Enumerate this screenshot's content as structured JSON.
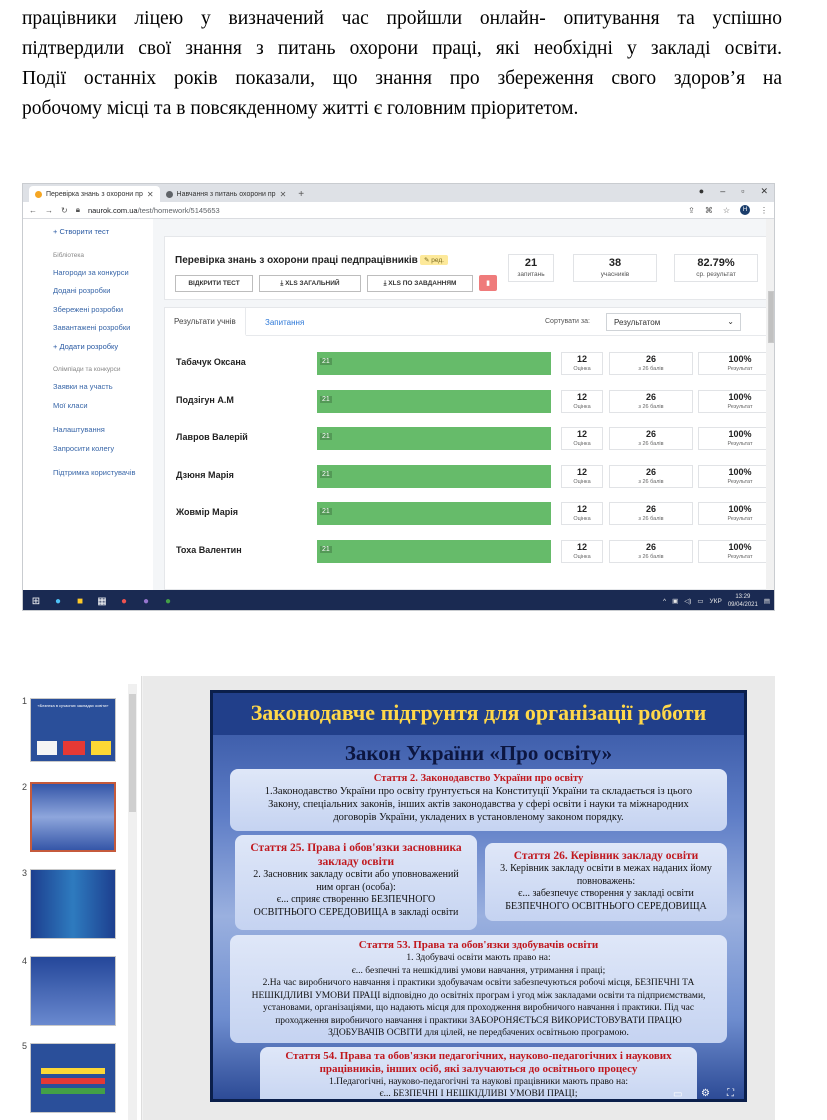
{
  "document": {
    "lines": [
      "працівники ліцею у визначений час пройшли онлайн- опитування та успішно",
      "підтвердили свої знання з питань охорони праці, які необхідні у закладі освіти.",
      "Події останніх років показали, що знання про збереження свого здоров’я на",
      "робочому місці та в повсякденному житті є головним пріоритетом."
    ]
  },
  "browser": {
    "tabs": [
      {
        "label": "Перевірка знань з охорони пр"
      },
      {
        "label": "Навчання з питань охорони пр"
      }
    ],
    "new_tab": "+",
    "url_host": "naurok.com.ua",
    "url_path": "/test/homework/5145653",
    "profile_initial": "Н"
  },
  "sidebar": {
    "create_test": "+ Створити тест",
    "library_title": "Бібліотека",
    "library_items": [
      "Нагороди за конкурси",
      "Додані розробки",
      "Збережені розробки",
      "Завантажені розробки"
    ],
    "add_dev": "+ Додати розробку",
    "olymp_title": "Олімпіади та конкурси",
    "olymp_items": [
      "Заявки на участь",
      "Мої класи"
    ],
    "other_items": [
      "Налаштування",
      "Запросити колегу"
    ],
    "support": "Підтримка користувачів"
  },
  "test": {
    "title": "Перевірка знань з охорони праці педпрацівників",
    "edit_badge": "ред.",
    "open_button": "ВІДКРИТИ ТЕСТ",
    "xls_total": "XLS ЗАГАЛЬНИЙ",
    "xls_tasks": "XLS ПО ЗАВДАННЯМ",
    "stats": [
      {
        "value": "21",
        "label": "запитань"
      },
      {
        "value": "38",
        "label": "учасників"
      },
      {
        "value": "82.79%",
        "label": "ср. результат"
      }
    ]
  },
  "results": {
    "tab_results": "Результати учнів",
    "tab_questions": "Запитання",
    "sort_label": "Сортувати за:",
    "sort_value": "Результатом",
    "rows": [
      {
        "name": "Табачук Оксана",
        "bar": "21",
        "grade": "12",
        "grade_label": "Оцінка",
        "points": "26",
        "points_label": "з 26 балів",
        "result": "100%",
        "result_label": "Результат"
      },
      {
        "name": "Подзігун А.М",
        "bar": "21",
        "grade": "12",
        "grade_label": "Оцінка",
        "points": "26",
        "points_label": "з 26 балів",
        "result": "100%",
        "result_label": "Результат"
      },
      {
        "name": "Лавров Валерій",
        "bar": "21",
        "grade": "12",
        "grade_label": "Оцінка",
        "points": "26",
        "points_label": "з 26 балів",
        "result": "100%",
        "result_label": "Результат"
      },
      {
        "name": "Дзюня Марія",
        "bar": "21",
        "grade": "12",
        "grade_label": "Оцінка",
        "points": "26",
        "points_label": "з 26 балів",
        "result": "100%",
        "result_label": "Результат"
      },
      {
        "name": "Жовмір Марія",
        "bar": "21",
        "grade": "12",
        "grade_label": "Оцінка",
        "points": "26",
        "points_label": "з 26 балів",
        "result": "100%",
        "result_label": "Результат"
      },
      {
        "name": "Тоха Валентин",
        "bar": "21",
        "grade": "12",
        "grade_label": "Оцінка",
        "points": "26",
        "points_label": "з 26 балів",
        "result": "100%",
        "result_label": "Результат"
      }
    ]
  },
  "taskbar": {
    "lang": "УКР",
    "time": "13:29",
    "date": "09/04/2021"
  },
  "presentation": {
    "thumb_numbers": [
      "1",
      "2",
      "3",
      "4",
      "5"
    ],
    "thumb1_text": "«Безпека в сучасних закладах освіти»",
    "header": "Законодавче підгрунтя для організації роботи",
    "subtitle": "Закон України «Про освіту»",
    "art2_title": "Стаття 2. Законодавство України про освіту",
    "art2_lines": [
      "1.Законодавство України про освіту ґрунтується на Конституції України та складається із цього",
      "Закону, спеціальних законів, інших актів законодавства у сфері освіти і науки та міжнародних",
      "договорів України, укладених в установленому законом порядку."
    ],
    "art25_title": [
      "Стаття 25. Права і обов'язки засновника",
      "закладу освіти"
    ],
    "art25_lines": [
      "2. Засновник закладу освіти або уповноважений",
      "ним орган (особа):",
      "є... сприяє створенню БЕЗПЕЧНОГО",
      "ОСВІТНЬОГО СЕРЕДОВИЩА в закладі освіти"
    ],
    "art26_title": "Стаття 26. Керівник закладу освіти",
    "art26_lines": [
      "3. Керівник закладу освіти в межах наданих йому",
      "повноважень:",
      "є... забезпечує створення у закладі освіти",
      "БЕЗПЕЧНОГО ОСВІТНЬОГО СЕРЕДОВИЩА"
    ],
    "art53_title": "Стаття 53. Права та обов'язки здобувачів освіти",
    "art53_lines": [
      "1. Здобувачі освіти мають право на:",
      "є... безпечні та нешкідливі умови навчання, утримання і праці;",
      "2.На час виробничого навчання і практики здобувачам освіти забезпечуються робочі місця, БЕЗПЕЧНІ ТА",
      "НЕШКІДЛИВІ УМОВИ ПРАЦІ відповідно до освітніх програм і угод між закладами освіти та підприємствами,",
      "установами, організаціями, що надають місця для проходження виробничого навчання і практики. Під час",
      "проходження виробничого навчання і практики ЗАБОРОНЯЄТЬСЯ ВИКОРИСТОВУВАТИ ПРАЦЮ",
      "ЗДОБУВАЧІВ ОСВІТИ для цілей, не передбачених освітньою програмою."
    ],
    "art54_title": [
      "Стаття 54. Права та обов'язки педагогічних, науково-педагогічних і наукових",
      "працівників, інших осіб, які залучаються до освітнього процесу"
    ],
    "art54_lines": [
      "1.Педагогічні, науково-педагогічні та наукові працівники мають право на:",
      "є... БЕЗПЕЧНІ І НЕШКІДЛИВІ УМОВИ ПРАЦІ;"
    ]
  },
  "colors": {
    "bar_green": "#66bb6a",
    "slide_title_yellow": "#ffd84a",
    "article_red": "#c0181e",
    "link_blue": "#2e79d8"
  }
}
